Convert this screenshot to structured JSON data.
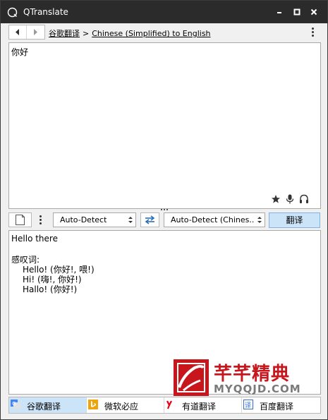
{
  "window": {
    "title": "QTranslate"
  },
  "navbar": {
    "service": "谷歌翻译",
    "separator": ">",
    "direction": "Chinese (Simplified) to English"
  },
  "source": {
    "text": "你好"
  },
  "controls": {
    "source_lang": "Auto-Detect",
    "target_lang": "Auto-Detect (Chines...",
    "translate_label": "翻译"
  },
  "output": {
    "lines": [
      "Hello there",
      "",
      "感叹词:",
      "Hello! (你好!, 喂!)",
      "Hi! (嗨!, 你好!)",
      "Hallo! (你好!)"
    ]
  },
  "watermark": {
    "title": "芊芊精典",
    "url": "MYQQJD.COM"
  },
  "tabs": [
    {
      "label": "谷歌翻译",
      "icon": "google-translate-icon",
      "active": true
    },
    {
      "label": "微软必应",
      "icon": "bing-icon",
      "active": false
    },
    {
      "label": "有道翻译",
      "icon": "youdao-icon",
      "active": false
    },
    {
      "label": "百度翻译",
      "icon": "baidu-icon",
      "active": false
    }
  ],
  "colors": {
    "titlebar": "#2b2b2b",
    "active_tab": "#cce4f7",
    "translate_button": "#cce4f7",
    "watermark_red": "#c8161d"
  }
}
